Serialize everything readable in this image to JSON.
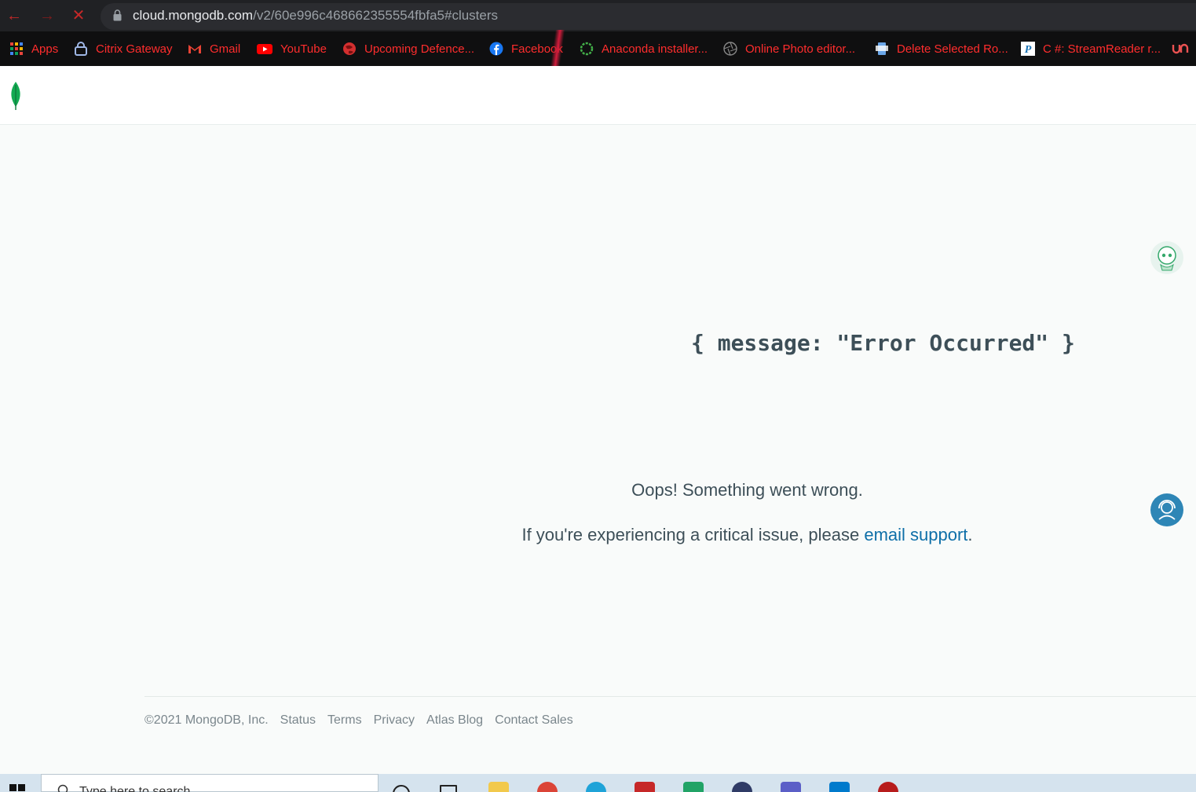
{
  "browser": {
    "url_host": "cloud.mongodb.com",
    "url_path": "/v2/60e996c468662355554fbfa5#clusters",
    "nav": {
      "back": "←",
      "forward": "→",
      "stop": "✕"
    },
    "bookmarks": [
      {
        "label": "Apps",
        "icon": "apps-grid-icon"
      },
      {
        "label": "Citrix Gateway",
        "icon": "citrix-icon"
      },
      {
        "label": "Gmail",
        "icon": "gmail-icon"
      },
      {
        "label": "YouTube",
        "icon": "youtube-icon"
      },
      {
        "label": "Upcoming Defence...",
        "icon": "globe-icon"
      },
      {
        "label": "Facebook",
        "icon": "facebook-icon"
      },
      {
        "label": "Anaconda installer...",
        "icon": "anaconda-icon"
      },
      {
        "label": "Online Photo editor...",
        "icon": "aperture-icon"
      },
      {
        "label": "Delete Selected Ro...",
        "icon": "page-icon"
      },
      {
        "label": "C #: StreamReader r...",
        "icon": "p-icon"
      }
    ]
  },
  "main": {
    "code_message": "{ message: \"Error Occurred\" }",
    "oops": "Oops! Something went wrong.",
    "critical_prefix": "If you're experiencing a critical issue, please ",
    "critical_link": "email support",
    "critical_suffix": "."
  },
  "footer": {
    "copyright": "©2021 MongoDB, Inc.",
    "links": [
      "Status",
      "Terms",
      "Privacy",
      "Atlas Blog",
      "Contact Sales"
    ]
  },
  "taskbar": {
    "search_placeholder": "Type here to search"
  },
  "colors": {
    "brand_green": "#13aa52",
    "link": "#0e6fa8",
    "text": "#3d4f58",
    "bookmark_red": "#ff2d2d"
  }
}
